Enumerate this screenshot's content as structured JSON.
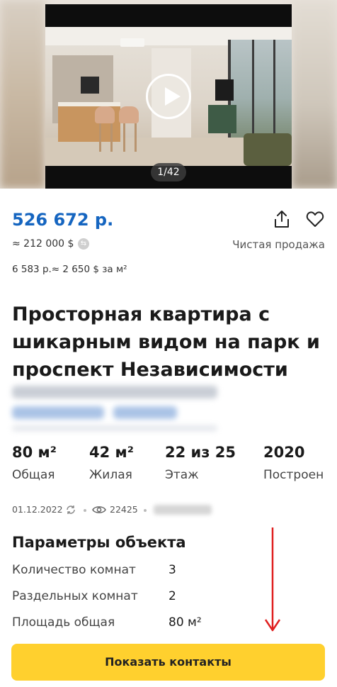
{
  "gallery": {
    "counter": "1/42",
    "media_type": "video"
  },
  "price": {
    "main": "526 672 р.",
    "usd": "≈ 212 000 $",
    "per_m2": "6 583 р.≈ 2 650 $ за м²",
    "sale_type": "Чистая продажа",
    "accent_color": "#1565c0"
  },
  "listing": {
    "title": "Просторная квартира с шикарным видом на парк и проспект Независимости"
  },
  "stats": [
    {
      "value": "80 м²",
      "label": "Общая"
    },
    {
      "value": "42 м²",
      "label": "Жилая"
    },
    {
      "value": "22 из 25",
      "label": "Этаж"
    },
    {
      "value": "2020",
      "label": "Построен"
    }
  ],
  "meta": {
    "date": "01.12.2022",
    "views": "22425"
  },
  "params": {
    "title": "Параметры объекта",
    "rows": [
      {
        "label": "Количество комнат",
        "value": "3"
      },
      {
        "label": "Раздельных комнат",
        "value": "2"
      },
      {
        "label": "Площадь общая",
        "value": "80 м²"
      }
    ]
  },
  "actions": {
    "contacts_label": "Показать контакты",
    "button_color": "#ffd02e"
  },
  "icons": [
    "play-icon",
    "share-icon",
    "heart-icon",
    "currency-switch-icon",
    "refresh-icon",
    "eye-icon"
  ]
}
